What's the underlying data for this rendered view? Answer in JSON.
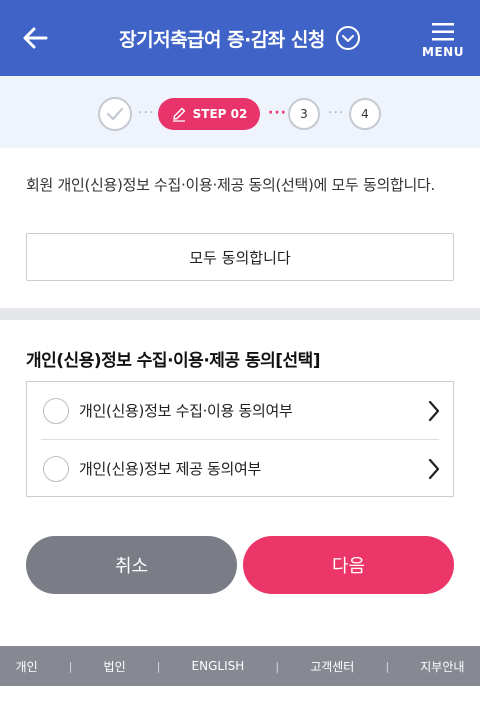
{
  "header": {
    "title": "장기저축급여 증·감좌 신청",
    "menu_label": "MENU",
    "back_icon": "arrow-left-icon",
    "chevron_icon": "chevron-down-circle-icon",
    "menu_icon": "hamburger-icon",
    "bg_color": "#3f63c6"
  },
  "steps": {
    "current_label": "STEP 02",
    "step3": "3",
    "step4": "4",
    "done_icon": "check-icon",
    "current_icon": "pencil-icon",
    "accent_color": "#e8336b"
  },
  "intro_text": "회원 개인(신용)정보 수집·이용·제공 동의(선택)에 모두 동의합니다.",
  "agree_all_label": "모두 동의합니다",
  "section_title": "개인(신용)정보 수집·이용·제공 동의[선택]",
  "consent_items": [
    {
      "label": "개인(신용)정보 수집·이용 동의여부"
    },
    {
      "label": "개인(신용)정보 제공 동의여부"
    }
  ],
  "buttons": {
    "cancel": "취소",
    "next": "다음"
  },
  "footer": [
    "개인",
    "법인",
    "ENGLISH",
    "고객센터",
    "지부안내"
  ]
}
